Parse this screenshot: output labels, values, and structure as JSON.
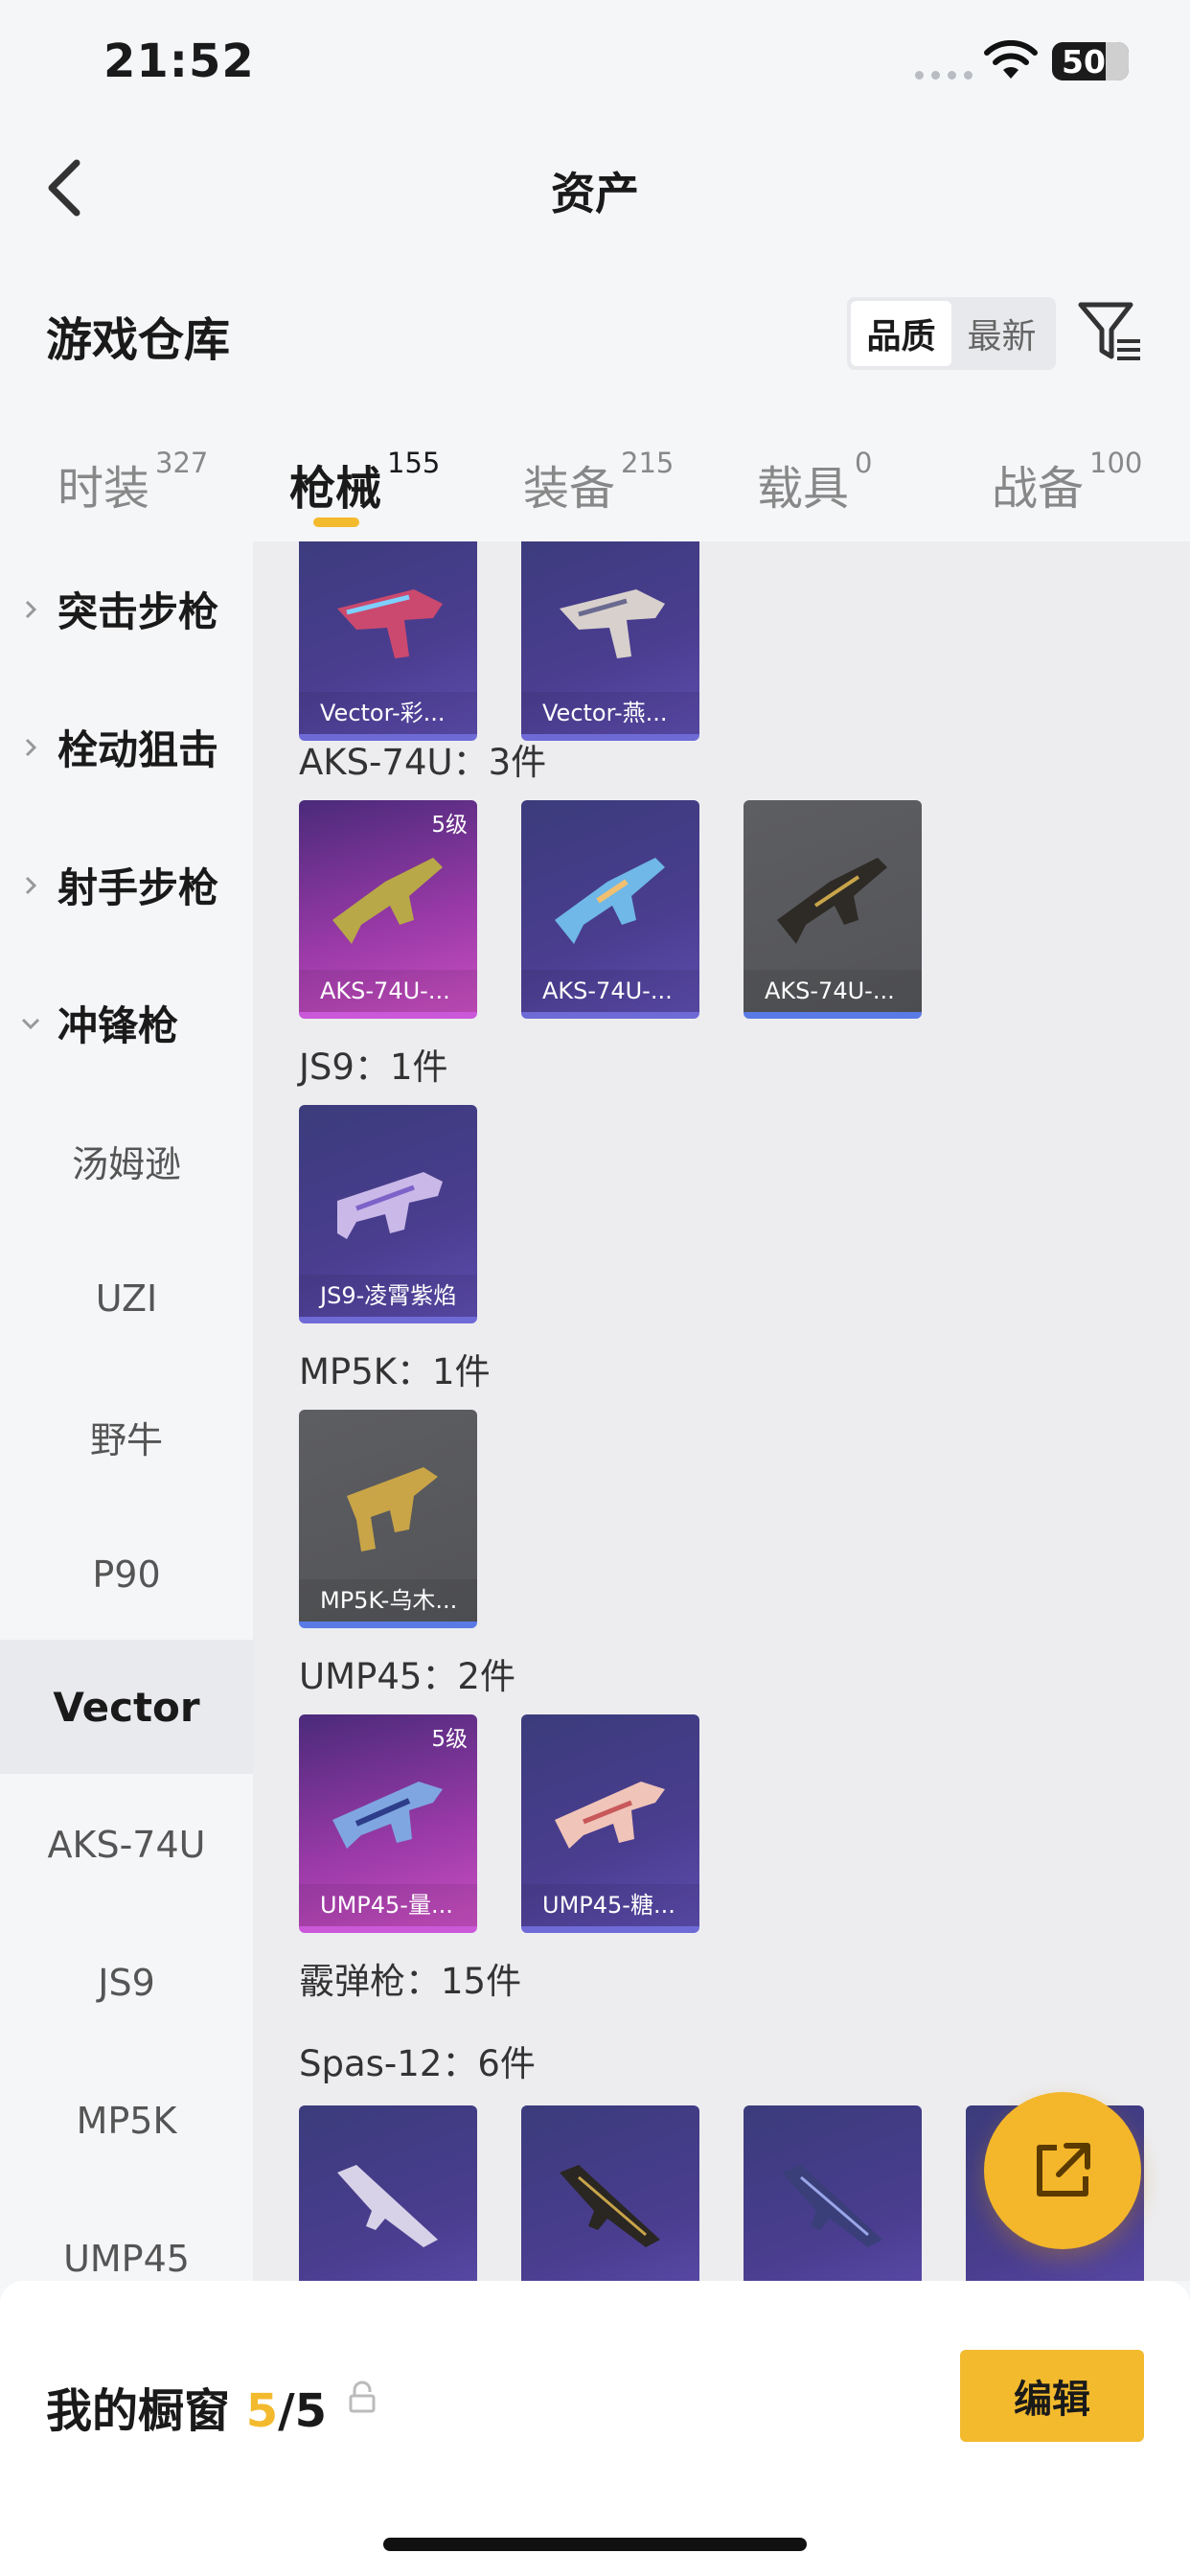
{
  "status_bar": {
    "time": "21:52",
    "battery": "50"
  },
  "header": {
    "title": "资产"
  },
  "section": {
    "title": "游戏仓库",
    "sort_options": [
      "品质",
      "最新"
    ]
  },
  "tabs": [
    {
      "label": "时装",
      "count": "327"
    },
    {
      "label": "枪械",
      "count": "155"
    },
    {
      "label": "装备",
      "count": "215"
    },
    {
      "label": "载具",
      "count": "0"
    },
    {
      "label": "战备",
      "count": "100"
    }
  ],
  "sidebar": {
    "groups": [
      "突击步枪",
      "栓动狙击",
      "射手步枪",
      "冲锋枪"
    ],
    "items": [
      "汤姆逊",
      "UZI",
      "野牛",
      "P90",
      "Vector",
      "AKS-74U",
      "JS9",
      "MP5K",
      "UMP45"
    ],
    "active": "Vector"
  },
  "content": {
    "vector_cards": [
      "Vector-彩...",
      "Vector-燕..."
    ],
    "aks": {
      "label": "AKS-74U：3件",
      "cards": [
        "AKS-74U-...",
        "AKS-74U-...",
        "AKS-74U-..."
      ],
      "badge": "5级"
    },
    "js9": {
      "label": "JS9：1件",
      "cards": [
        "JS9-凌霄紫焰"
      ]
    },
    "mp5k": {
      "label": "MP5K：1件",
      "cards": [
        "MP5K-乌木..."
      ]
    },
    "ump45": {
      "label": "UMP45：2件",
      "cards": [
        "UMP45-量...",
        "UMP45-糖..."
      ],
      "badge": "5级"
    },
    "shotgun": {
      "label": "霰弹枪：15件"
    },
    "spas": {
      "label": "Spas-12：6件"
    }
  },
  "bottom": {
    "showcase_label": "我的橱窗",
    "count_current": "5",
    "count_total": "/5",
    "edit_label": "编辑"
  },
  "colors": {
    "accent": "#f3ba2e",
    "card_purple": "#4a3d8f",
    "card_magenta": "#9b3aa8",
    "card_gray": "#5d5e62"
  }
}
